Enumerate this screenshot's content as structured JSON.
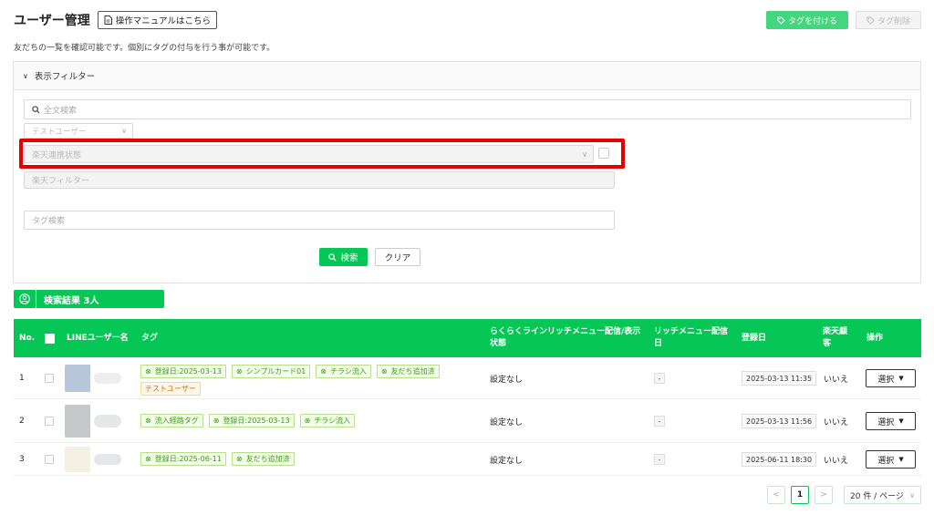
{
  "header": {
    "title": "ユーザー管理",
    "manual_label": "操作マニュアルはこちら",
    "tag_add_label": "タグを付ける",
    "tag_delete_label": "タグ削除",
    "description": "友だちの一覧を確認可能です。個別にタグの付与を行う事が可能です。"
  },
  "filter": {
    "title": "表示フィルター",
    "fulltext_placeholder": "全文検索",
    "test_user_placeholder": "テストユーザー",
    "rakuten_status_placeholder": "楽天連携状態",
    "rakuten_filter_placeholder": "楽天フィルター",
    "tag_search_placeholder": "タグ検索",
    "search_label": "検索",
    "clear_label": "クリア"
  },
  "results": {
    "label": "検索結果 3人"
  },
  "table": {
    "columns": {
      "no": "No.",
      "line_user": "LINEユーザー名",
      "tags": "タグ",
      "rich_menu_status": "らくらくラインリッチメニュー配信/表示状態",
      "rich_menu_date": "リッチメニュー配信日",
      "registered": "登録日",
      "rakuten": "楽天顧客",
      "action": "操作"
    },
    "rows": [
      {
        "no": "1",
        "tags": [
          {
            "label": "登録日:2025-03-13",
            "color": "green"
          },
          {
            "label": "シンプルカード01",
            "color": "green"
          },
          {
            "label": "チラシ流入",
            "color": "green"
          },
          {
            "label": "友だち追加済",
            "color": "green"
          },
          {
            "label": "テストユーザー",
            "color": "orange"
          }
        ],
        "rich_menu_status": "設定なし",
        "rich_menu_date": "-",
        "registered": "2025-03-13 11:35",
        "rakuten": "いいえ",
        "action": "選択"
      },
      {
        "no": "2",
        "tags": [
          {
            "label": "流入経路タグ",
            "color": "green"
          },
          {
            "label": "登録日:2025-03-13",
            "color": "green"
          },
          {
            "label": "チラシ流入",
            "color": "green"
          }
        ],
        "rich_menu_status": "設定なし",
        "rich_menu_date": "-",
        "registered": "2025-03-13 11:56",
        "rakuten": "いいえ",
        "action": "選択"
      },
      {
        "no": "3",
        "tags": [
          {
            "label": "登録日:2025-06-11",
            "color": "green"
          },
          {
            "label": "友だち追加済",
            "color": "green"
          }
        ],
        "rich_menu_status": "設定なし",
        "rich_menu_date": "-",
        "registered": "2025-06-11 18:30",
        "rakuten": "いいえ",
        "action": "選択"
      }
    ]
  },
  "pagination": {
    "prev": "<",
    "current": "1",
    "next": ">",
    "per_page": "20 件 / ページ"
  },
  "colors": {
    "accent": "#06c755",
    "highlight": "#e60000"
  }
}
